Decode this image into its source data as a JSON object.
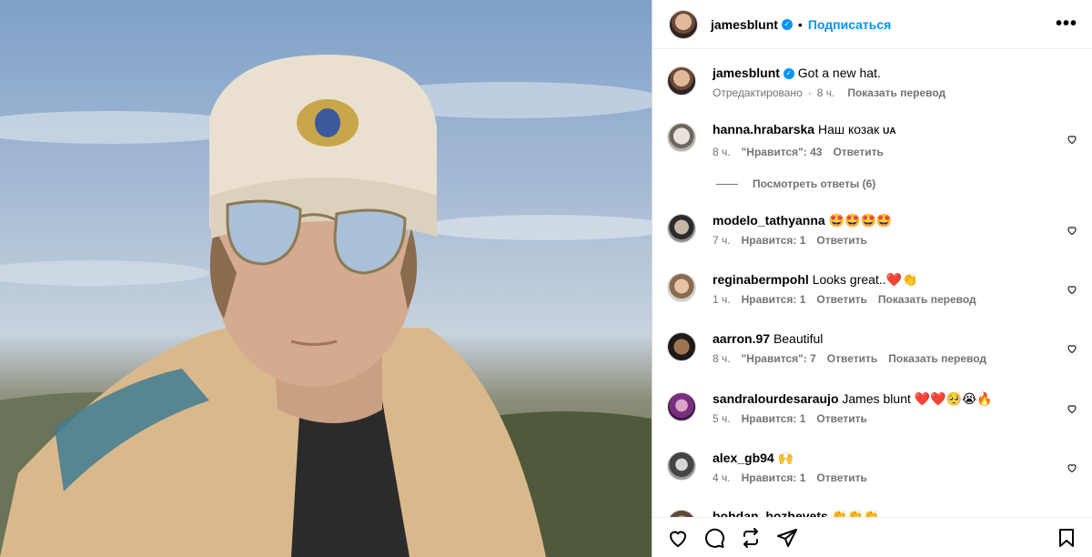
{
  "header": {
    "username": "jamesblunt",
    "follow_label": "Подписаться",
    "dot": "•",
    "more": "•••"
  },
  "caption": {
    "username": "jamesblunt",
    "text": "Got a new hat.",
    "edited": "Отредактировано",
    "time": "8 ч.",
    "translate": "Показать перевод"
  },
  "comments": [
    {
      "username": "hanna.hrabarska",
      "text": "Наш козак",
      "tag": "UA",
      "time": "8 ч.",
      "likes": "\"Нравится\": 43",
      "reply": "Ответить",
      "translate": ""
    },
    {
      "username": "modelo_tathyanna",
      "text": "🤩🤩🤩🤩",
      "time": "7 ч.",
      "likes": "Нравится: 1",
      "reply": "Ответить",
      "translate": ""
    },
    {
      "username": "reginabermpohl",
      "text": "Looks great..❤️👏",
      "time": "1 ч.",
      "likes": "Нравится: 1",
      "reply": "Ответить",
      "translate": "Показать перевод"
    },
    {
      "username": "aarron.97",
      "text": "Beautiful",
      "time": "8 ч.",
      "likes": "\"Нравится\": 7",
      "reply": "Ответить",
      "translate": "Показать перевод"
    },
    {
      "username": "sandralourdesaraujo",
      "text": "James blunt ❤️❤️🥺😭🔥",
      "time": "5 ч.",
      "likes": "Нравится: 1",
      "reply": "Ответить",
      "translate": ""
    },
    {
      "username": "alex_gb94",
      "text": "🙌",
      "time": "4 ч.",
      "likes": "Нравится: 1",
      "reply": "Ответить",
      "translate": ""
    },
    {
      "username": "bohdan_bozhevets",
      "text": "👏👏👏",
      "time": "",
      "likes": "",
      "reply": "",
      "translate": ""
    }
  ],
  "replies_label": "Посмотреть ответы (6)",
  "footer": {
    "icons": [
      "heart-icon",
      "comment-icon",
      "share-icon",
      "send-icon",
      "bookmark-icon"
    ]
  }
}
